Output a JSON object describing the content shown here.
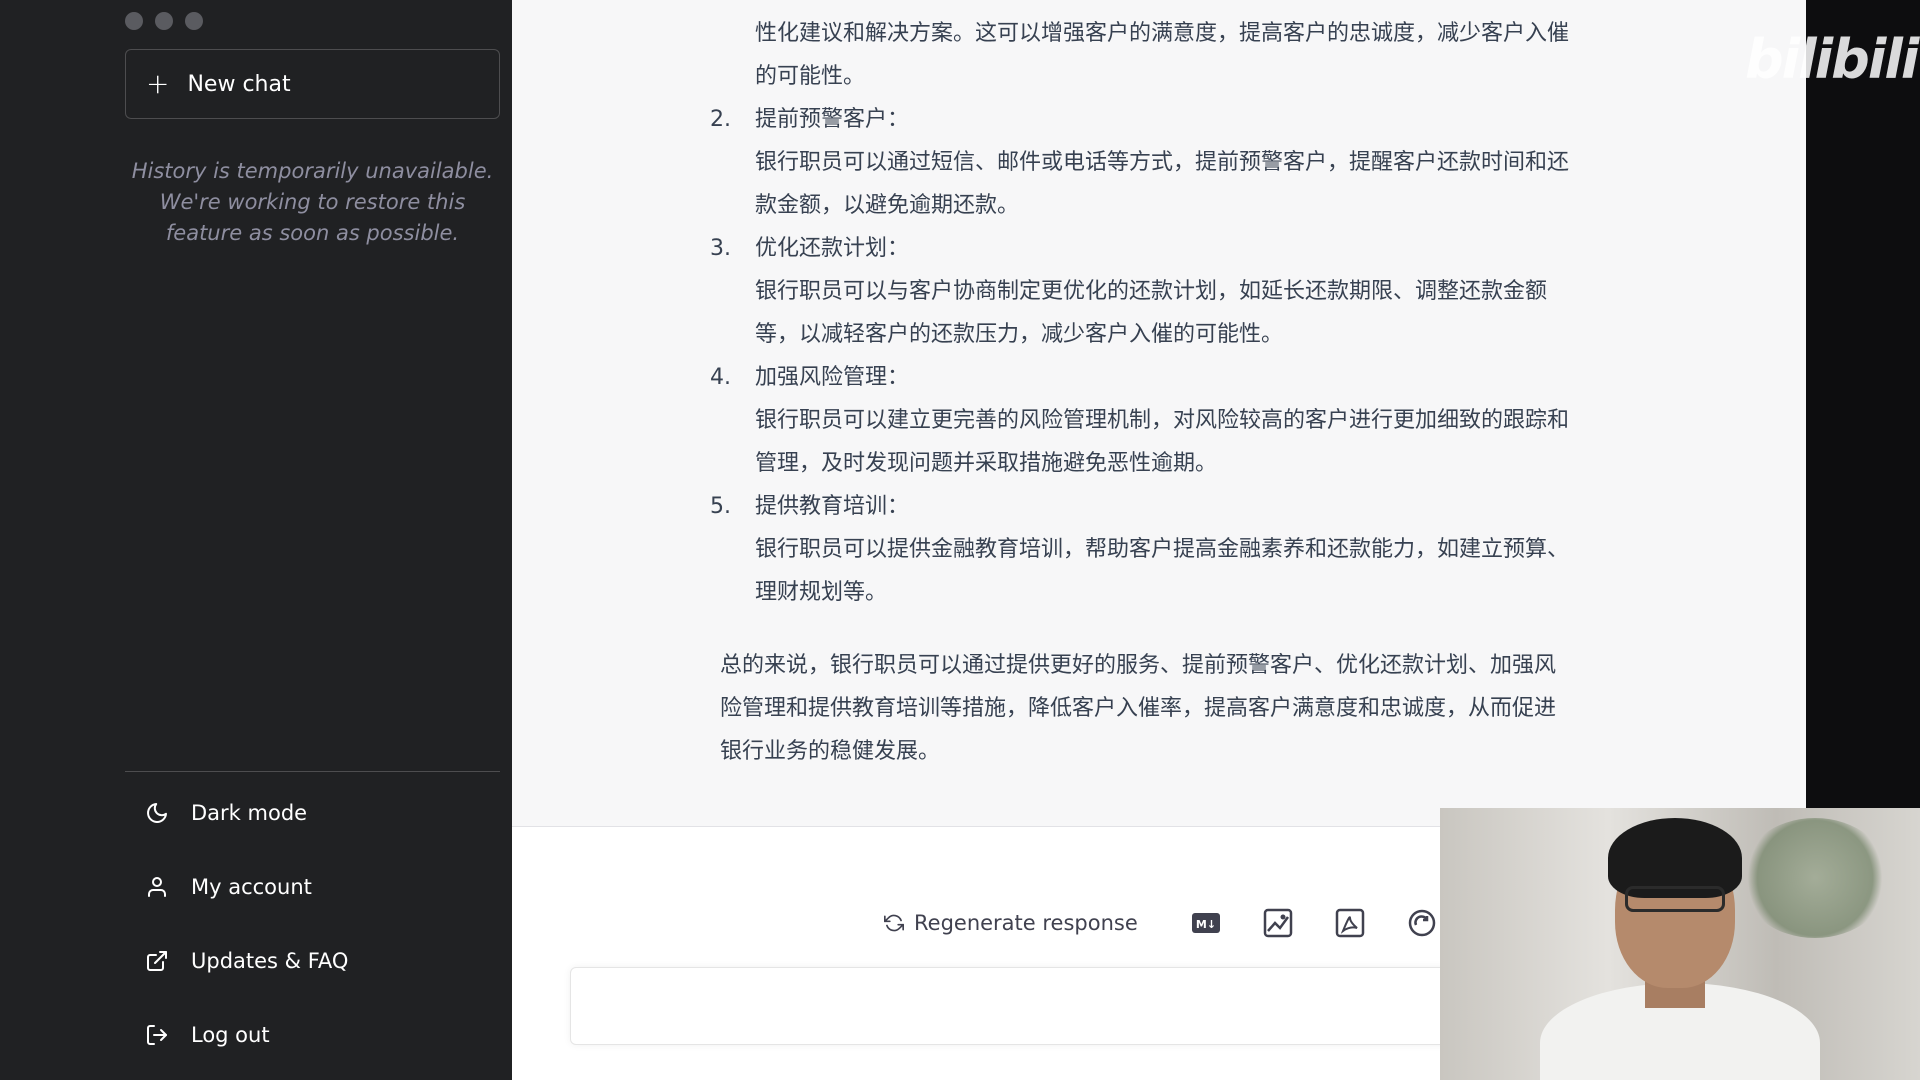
{
  "sidebar": {
    "new_chat_label": "New chat",
    "history_note": "History is temporarily unavailable. We're working to restore this feature as soon as possible.",
    "menu": [
      {
        "label": "Dark mode",
        "icon": "moon-icon"
      },
      {
        "label": "My account",
        "icon": "user-icon"
      },
      {
        "label": "Updates & FAQ",
        "icon": "external-link-icon"
      },
      {
        "label": "Log out",
        "icon": "logout-icon"
      }
    ]
  },
  "answer": {
    "intro_cont": "性化建议和解决方案。这可以增强客户的满意度，提高客户的忠诚度，减少客户入催的可能性。",
    "items": [
      {
        "num": "2.",
        "title": "提前预警客户：",
        "body": "银行职员可以通过短信、邮件或电话等方式，提前预警客户，提醒客户还款时间和还款金额，以避免逾期还款。"
      },
      {
        "num": "3.",
        "title": "优化还款计划：",
        "body": "银行职员可以与客户协商制定更优化的还款计划，如延长还款期限、调整还款金额等，以减轻客户的还款压力，减少客户入催的可能性。"
      },
      {
        "num": "4.",
        "title": "加强风险管理：",
        "body": "银行职员可以建立更完善的风险管理机制，对风险较高的客户进行更加细致的跟踪和管理，及时发现问题并采取措施避免恶性逾期。"
      },
      {
        "num": "5.",
        "title": "提供教育培训：",
        "body": "银行职员可以提供金融教育培训，帮助客户提高金融素养和还款能力，如建立预算、理财规划等。"
      }
    ],
    "summary": "总的来说，银行职员可以通过提供更好的服务、提前预警客户、优化还款计划、加强风险管理和提供教育培训等措施，降低客户入催率，提高客户满意度和忠诚度，从而促进银行业务的稳健发展。"
  },
  "actions": {
    "regenerate_label": "Regenerate response",
    "tools": [
      "markdown-export-icon",
      "image-export-icon",
      "pdf-export-icon",
      "share-icon"
    ]
  },
  "watermark": "bilibili"
}
